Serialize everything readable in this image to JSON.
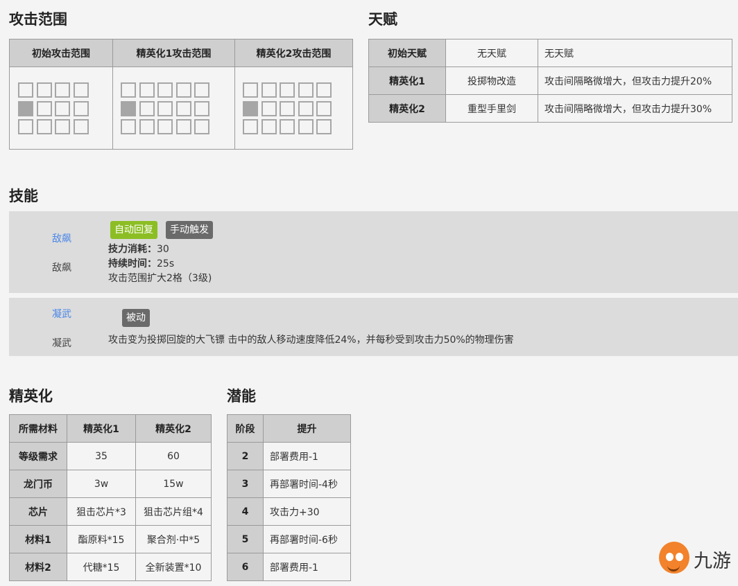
{
  "range": {
    "title": "攻击范围",
    "headers": [
      "初始攻击范围",
      "精英化1攻击范围",
      "精英化2攻击范围"
    ]
  },
  "talent": {
    "title": "天赋",
    "rows": [
      {
        "stage": "初始天赋",
        "name": "无天赋",
        "desc": "无天赋"
      },
      {
        "stage": "精英化1",
        "name": "投掷物改造",
        "desc": "攻击间隔略微增大，但攻击力提升20%"
      },
      {
        "stage": "精英化2",
        "name": "重型手里剑",
        "desc": "攻击间隔略微增大，但攻击力提升30%"
      }
    ]
  },
  "skills": {
    "title": "技能",
    "s1": {
      "link": "敌飙",
      "name": "敌飙",
      "tag1": "自动回复",
      "tag2": "手动触发",
      "cost_label": "技力消耗：",
      "cost": "30",
      "dur_label": "持续时间：",
      "dur": "25s",
      "desc": "攻击范围扩大2格（3级)"
    },
    "s2": {
      "link": "凝武",
      "name": "凝武",
      "tag": "被动",
      "desc": "攻击变为投掷回旋的大飞镖 击中的敌人移动速度降低24%，并每秒受到攻击力50%的物理伤害"
    }
  },
  "elite": {
    "title": "精英化",
    "headers": [
      "所需材料",
      "精英化1",
      "精英化2"
    ],
    "rows": [
      [
        "等级需求",
        "35",
        "60"
      ],
      [
        "龙门币",
        "3w",
        "15w"
      ],
      [
        "芯片",
        "狙击芯片*3",
        "狙击芯片组*4"
      ],
      [
        "材料1",
        "酯原料*15",
        "聚合剂·中*5"
      ],
      [
        "材料2",
        "代糖*15",
        "全新装置*10"
      ]
    ]
  },
  "potential": {
    "title": "潜能",
    "headers": [
      "阶段",
      "提升"
    ],
    "rows": [
      [
        "2",
        "部署费用-1"
      ],
      [
        "3",
        "再部署时间-4秒"
      ],
      [
        "4",
        "攻击力+30"
      ],
      [
        "5",
        "再部署时间-6秒"
      ],
      [
        "6",
        "部署费用-1"
      ]
    ]
  },
  "logo": {
    "text": "九游"
  },
  "colors": {
    "link": "#4a86e8",
    "auto_tag": "#8cbe24",
    "manual_tag": "#6a6a6a",
    "header_bg": "#cfcfcf"
  }
}
